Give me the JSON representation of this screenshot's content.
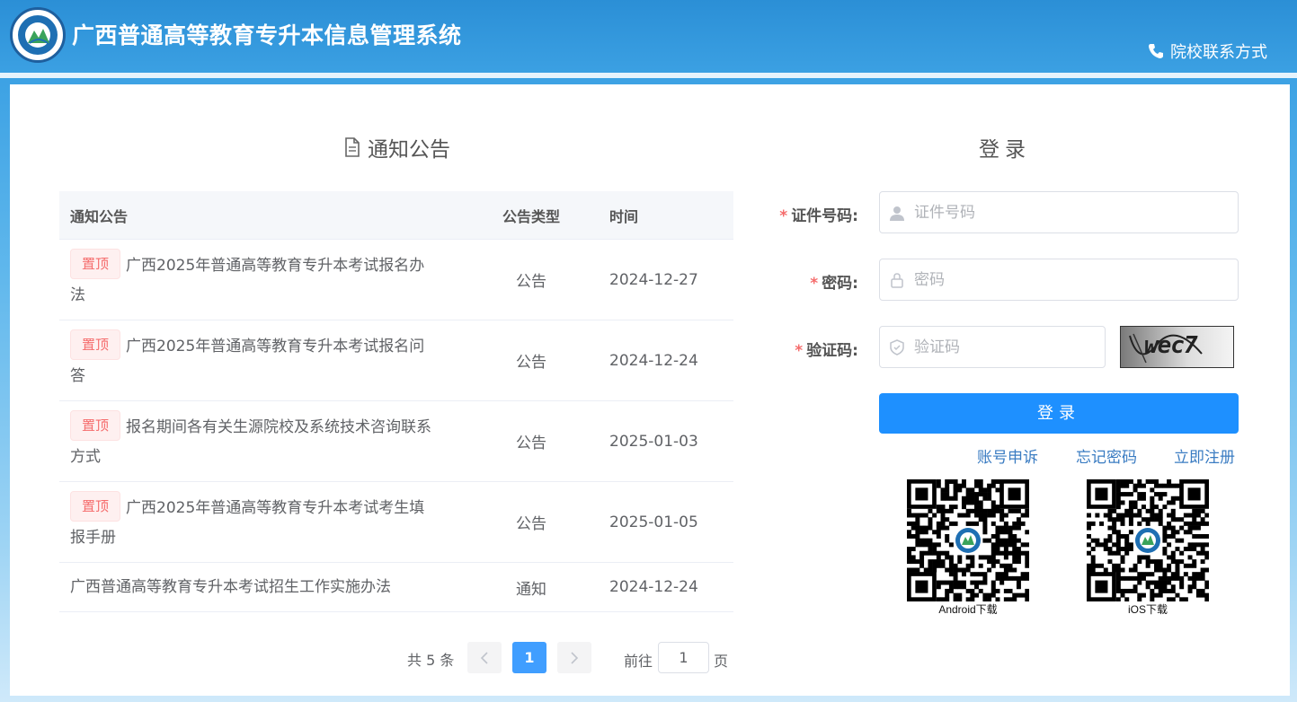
{
  "header": {
    "title": "广西普通高等教育专升本信息管理系统",
    "contact_label": "院校联系方式"
  },
  "notice": {
    "title": "通知公告",
    "columns": [
      "通知公告",
      "公告类型",
      "时间"
    ],
    "pin_label": "置顶",
    "rows": [
      {
        "pinned": true,
        "title": "广西2025年普通高等教育专升本考试报名办法",
        "type": "公告",
        "date": "2024-12-27"
      },
      {
        "pinned": true,
        "title": "广西2025年普通高等教育专升本考试报名问答",
        "type": "公告",
        "date": "2024-12-24"
      },
      {
        "pinned": true,
        "title": "报名期间各有关生源院校及系统技术咨询联系方式",
        "type": "公告",
        "date": "2025-01-03"
      },
      {
        "pinned": true,
        "title": "广西2025年普通高等教育专升本考试考生填报手册",
        "type": "公告",
        "date": "2025-01-05"
      },
      {
        "pinned": false,
        "title": "广西普通高等教育专升本考试招生工作实施办法",
        "type": "通知",
        "date": "2024-12-24"
      }
    ],
    "pagination": {
      "total_text": "共 5 条",
      "current_page": "1",
      "goto_prefix": "前往",
      "goto_value": "1",
      "goto_suffix": "页"
    }
  },
  "login": {
    "title": "登录",
    "id_label": "证件号码:",
    "id_placeholder": "证件号码",
    "password_label": "密码:",
    "password_placeholder": "密码",
    "captcha_label": "验证码:",
    "captcha_placeholder": "验证码",
    "captcha_text": "wec7",
    "required_mark": "*",
    "submit_label": "登录",
    "links": [
      "账号申诉",
      "忘记密码",
      "立即注册"
    ],
    "apps": [
      {
        "caption": "Android下载"
      },
      {
        "caption": "iOS下载"
      }
    ]
  },
  "colors": {
    "header_blue": "#2b8fd6",
    "primary": "#1e90ff",
    "link": "#3a7cc2",
    "tag_red": "#f56c6c"
  }
}
